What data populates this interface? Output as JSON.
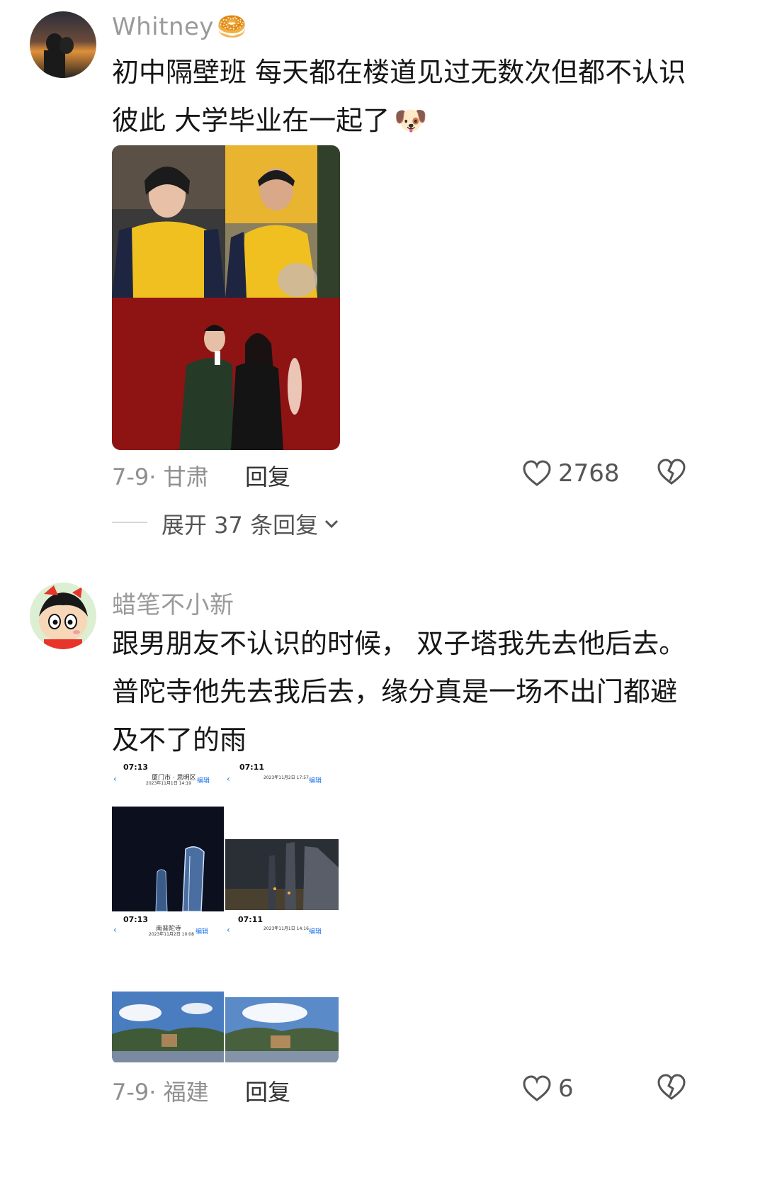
{
  "comments": [
    {
      "username": "Whitney",
      "username_emoji": "🥯",
      "text_line1": "初中隔壁班 每天都在楼道见过无数次但都不认识",
      "text_line2": "彼此 大学毕业在一起了",
      "text_emoji": "🐶",
      "date_location": "7-9· 甘肃",
      "reply_label": "回复",
      "like_count": "2768",
      "expand_label": "展开 37 条回复",
      "expand_chevron": "⌄"
    },
    {
      "username": "蜡笔不小新",
      "text_line1": "跟男朋友不认识的时候， 双子塔我先去他后去。",
      "text_line2": "普陀寺他先去我后去，缘分真是一场不出门都避",
      "text_line3": "及不了的雨",
      "date_location": "7-9· 福建",
      "reply_label": "回复",
      "like_count": "6",
      "phone_shots": [
        {
          "time": "07:13",
          "place": "厦门市 · 思明区",
          "date": "2023年11月1日 14:19",
          "edit": "编辑"
        },
        {
          "time": "07:11",
          "place": "",
          "date": "2023年11月2日 17:57",
          "edit": "编辑"
        },
        {
          "time": "07:13",
          "place": "南普陀寺",
          "date": "2023年11月2日 10:08",
          "edit": "编辑"
        },
        {
          "time": "07:11",
          "place": "",
          "date": "2023年11月1日 14:16",
          "edit": "编辑"
        }
      ]
    }
  ],
  "icons": {
    "heart": "heart-icon",
    "dislike": "broken-heart-icon",
    "chevron": "chevron-down-icon"
  }
}
